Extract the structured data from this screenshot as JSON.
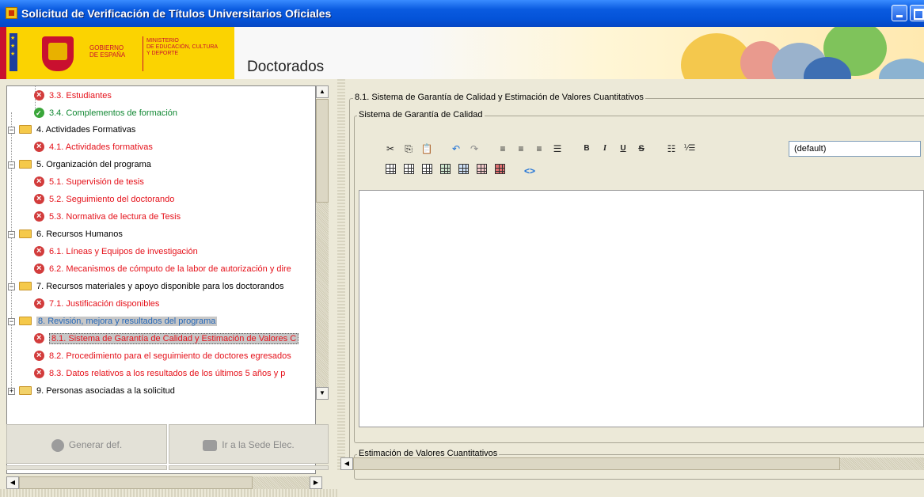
{
  "window": {
    "title": "Solicitud de Verificación de Títulos Universitarios Oficiales"
  },
  "banner": {
    "gov_line": "GOBIERNO\nDE ESPAÑA",
    "ministry_line": "MINISTERIO\nDE EDUCACIÓN, CULTURA\nY DEPORTE",
    "module_title": "Doctorados"
  },
  "tree": {
    "items": [
      {
        "label": "3.3. Estudiantes",
        "status": "error"
      },
      {
        "label": "3.4. Complementos de formación",
        "status": "ok"
      },
      {
        "label": "4. Actividades Formativas",
        "status": "folder"
      },
      {
        "label": "4.1. Actividades formativas",
        "status": "error"
      },
      {
        "label": "5. Organización del programa",
        "status": "folder"
      },
      {
        "label": "5.1. Supervisión de tesis",
        "status": "error"
      },
      {
        "label": "5.2. Seguimiento del doctorando",
        "status": "error"
      },
      {
        "label": "5.3. Normativa de lectura de Tesis",
        "status": "error"
      },
      {
        "label": "6. Recursos Humanos",
        "status": "folder"
      },
      {
        "label": "6.1. Líneas y Equipos de investigación",
        "status": "error"
      },
      {
        "label": "6.2. Mecanismos de cómputo de la labor de autorización y dire",
        "status": "error"
      },
      {
        "label": "7. Recursos materiales y apoyo disponible para los doctorandos",
        "status": "folder"
      },
      {
        "label": "7.1. Justificación disponibles",
        "status": "error"
      },
      {
        "label": "8. Revisión, mejora y resultados del programa",
        "status": "folder-selected"
      },
      {
        "label": "8.1. Sistema de Garantía de Calidad y Estimación de Valores C",
        "status": "error-selected"
      },
      {
        "label": "8.2. Procedimiento para el seguimiento de doctores egresados",
        "status": "error"
      },
      {
        "label": "8.3. Datos relativos a los resultados de los últimos 5 años y p",
        "status": "error"
      },
      {
        "label": "9. Personas asociadas a la solicitud",
        "status": "folder"
      }
    ]
  },
  "actions": {
    "generate_label": "Generar def.",
    "sede_label": "Ir a la Sede Elec."
  },
  "panel": {
    "section_title": "8.1. Sistema de Garantía de Calidad y Estimación de Valores Cuantitativos",
    "quality_legend": "Sistema de Garantía de Calidad",
    "estimation_legend": "Estimación de Valores Cuantitativos",
    "font_value": "(default)"
  },
  "toolbar": {
    "bold": "B",
    "italic": "I",
    "underline": "U",
    "strike": "S"
  }
}
